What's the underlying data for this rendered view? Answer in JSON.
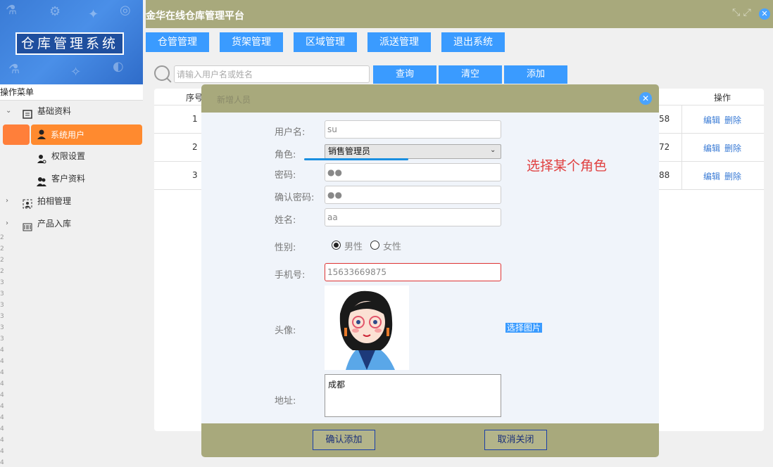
{
  "app_title": "金华在线仓库管理平台",
  "logo_text": "仓库管理系统",
  "sidebar": {
    "title": "操作菜单",
    "groups": [
      {
        "label": "基础资料",
        "icon": "folder-icon",
        "expanded": true
      },
      {
        "label": "拍相管理",
        "icon": "camera-icon",
        "expanded": false
      },
      {
        "label": "产品入库",
        "icon": "barcode-icon",
        "expanded": false
      }
    ],
    "sub_items": [
      {
        "label": "系统用户",
        "icon": "user-icon",
        "active": true
      },
      {
        "label": "权限设置",
        "icon": "key-user-icon",
        "active": false
      },
      {
        "label": "客户资料",
        "icon": "users-icon",
        "active": false
      }
    ]
  },
  "nav": [
    "仓管管理",
    "货架管理",
    "区域管理",
    "派送管理",
    "退出系统"
  ],
  "search": {
    "placeholder": "请输入用户名或姓名",
    "query_label": "查询",
    "clear_label": "清空",
    "add_label": "添加"
  },
  "table": {
    "headers": {
      "index": "序号",
      "action": "操作"
    },
    "rows": [
      {
        "index": "1",
        "tail": "58",
        "edit": "编辑",
        "delete": "删除"
      },
      {
        "index": "2",
        "tail": "72",
        "edit": "编辑",
        "delete": "删除"
      },
      {
        "index": "3",
        "tail": "88",
        "edit": "编辑",
        "delete": "删除"
      }
    ]
  },
  "modal": {
    "title": "新增人员",
    "fields": {
      "username": {
        "label": "用户名:",
        "value": "su"
      },
      "role": {
        "label": "角色:",
        "value": "销售管理员"
      },
      "password": {
        "label": "密码:",
        "value": "●●"
      },
      "confirm_password": {
        "label": "确认密码:",
        "value": "●●"
      },
      "name": {
        "label": "姓名:",
        "value": "aa"
      },
      "gender": {
        "label": "性别:",
        "options": [
          "男性",
          "女性"
        ],
        "selected": "男性"
      },
      "phone": {
        "label": "手机号:",
        "value": "15633669875"
      },
      "avatar": {
        "label": "头像:",
        "pick_label": "选择图片"
      },
      "address": {
        "label": "地址:",
        "value": "成都"
      }
    },
    "confirm_label": "确认添加",
    "cancel_label": "取消关闭"
  },
  "annotation": "选择某个角色",
  "colors": {
    "header": "#a8a97c",
    "button": "#3a9bff",
    "active_menu": "#ff8a2f",
    "annotation": "#e04040"
  }
}
